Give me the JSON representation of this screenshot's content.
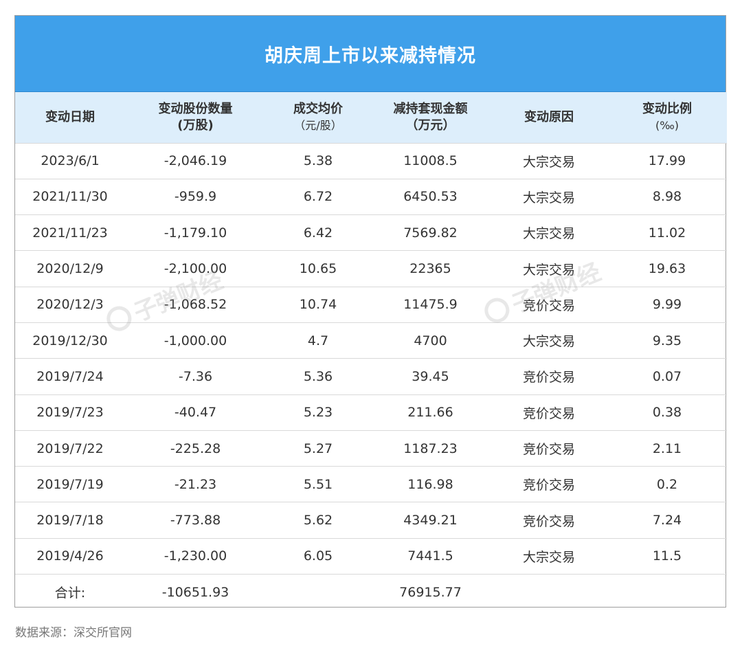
{
  "title": "胡庆周上市以来减持情况",
  "headers": [
    {
      "line1": "变动日期",
      "line2": ""
    },
    {
      "line1": "变动股份数量",
      "line2": "(万股)"
    },
    {
      "line1": "成交均价",
      "line2": "（元/股）"
    },
    {
      "line1": "减持套现金额",
      "line2": "（万元）"
    },
    {
      "line1": "变动原因",
      "line2": ""
    },
    {
      "line1": "变动比例",
      "line2": "(‰)"
    }
  ],
  "rows": [
    [
      "2023/6/1",
      "-2,046.19",
      "5.38",
      "11008.5",
      "大宗交易",
      "17.99"
    ],
    [
      "2021/11/30",
      "-959.9",
      "6.72",
      "6450.53",
      "大宗交易",
      "8.98"
    ],
    [
      "2021/11/23",
      "-1,179.10",
      "6.42",
      "7569.82",
      "大宗交易",
      "11.02"
    ],
    [
      "2020/12/9",
      "-2,100.00",
      "10.65",
      "22365",
      "大宗交易",
      "19.63"
    ],
    [
      "2020/12/3",
      "-1,068.52",
      "10.74",
      "11475.9",
      "竞价交易",
      "9.99"
    ],
    [
      "2019/12/30",
      "-1,000.00",
      "4.7",
      "4700",
      "大宗交易",
      "9.35"
    ],
    [
      "2019/7/24",
      "-7.36",
      "5.36",
      "39.45",
      "竞价交易",
      "0.07"
    ],
    [
      "2019/7/23",
      "-40.47",
      "5.23",
      "211.66",
      "竞价交易",
      "0.38"
    ],
    [
      "2019/7/22",
      "-225.28",
      "5.27",
      "1187.23",
      "竞价交易",
      "2.11"
    ],
    [
      "2019/7/19",
      "-21.23",
      "5.51",
      "116.98",
      "竞价交易",
      "0.2"
    ],
    [
      "2019/7/18",
      "-773.88",
      "5.62",
      "4349.21",
      "竞价交易",
      "7.24"
    ],
    [
      "2019/4/26",
      "-1,230.00",
      "6.05",
      "7441.5",
      "大宗交易",
      "11.5"
    ]
  ],
  "total_row": [
    "合计:",
    "-10651.93",
    "",
    "76915.77",
    "",
    ""
  ],
  "watermark": "子弹财经",
  "source": "数据来源：深交所官网",
  "colors": {
    "title_bg": "#3fa0ea",
    "header_bg": "#ddeefb",
    "border": "#9e9e9e"
  }
}
